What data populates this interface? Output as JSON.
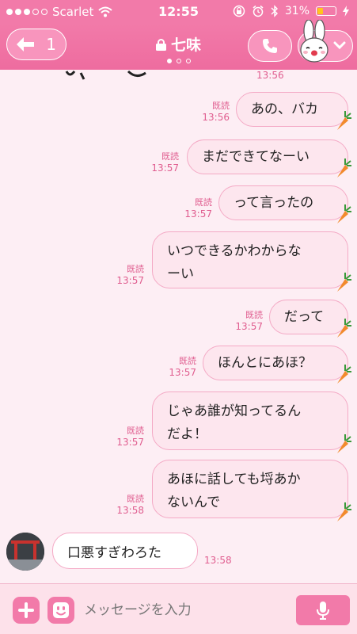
{
  "status_bar": {
    "carrier": "Scarlet",
    "time": "12:55",
    "battery": "31%",
    "battery_level": 0.31
  },
  "header": {
    "back_count": "1",
    "title": "七味",
    "page_index": 0,
    "page_count": 3
  },
  "partial_message": {
    "time": "13:56"
  },
  "messages": [
    {
      "direction": "out",
      "text": "あの、バカ",
      "read": "既読",
      "time": "13:56"
    },
    {
      "direction": "out",
      "text": "まだできてなーい",
      "read": "既読",
      "time": "13:57"
    },
    {
      "direction": "out",
      "text": "って言ったの",
      "read": "既読",
      "time": "13:57"
    },
    {
      "direction": "out",
      "lines": [
        "いつできるかわからな",
        "ーい"
      ],
      "read": "既読",
      "time": "13:57"
    },
    {
      "direction": "out",
      "text": "だって",
      "read": "既読",
      "time": "13:57"
    },
    {
      "direction": "out",
      "text": "ほんとにあほ？",
      "read": "既読",
      "time": "13:57"
    },
    {
      "direction": "out",
      "lines": [
        "じゃあ誰が知ってるん",
        "だよ！"
      ],
      "read": "既読",
      "time": "13:57"
    },
    {
      "direction": "out",
      "lines": [
        "あほに話しても埒あか",
        "ないんで"
      ],
      "read": "既読",
      "time": "13:58"
    },
    {
      "direction": "in",
      "text": "口悪すぎわろた",
      "time": "13:58"
    }
  ],
  "input": {
    "placeholder": "メッセージを入力"
  },
  "colors": {
    "accent": "#f27aa9",
    "bubble_out": "#fde6ee",
    "bubble_border": "#f4a9c5",
    "time_text": "#e05d8f",
    "background": "#fdeef4"
  },
  "icons": [
    "back-arrow-icon",
    "lock-icon",
    "phone-icon",
    "bunny-sticker-icon",
    "chevron-down-icon",
    "carrot-icon",
    "plus-icon",
    "emoji-icon",
    "microphone-icon"
  ]
}
